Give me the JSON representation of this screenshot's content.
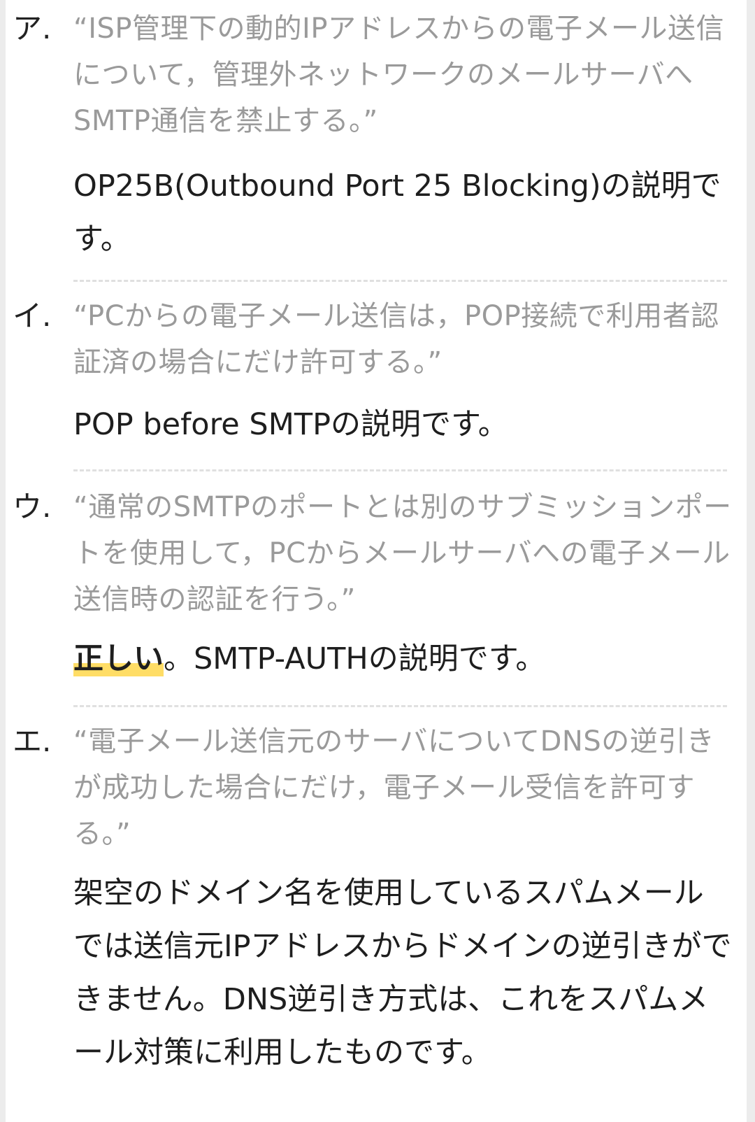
{
  "items": [
    {
      "marker": "ア.",
      "quote": "“ISP管理下の動的IPアドレスからの電子メール送信について，管理外ネットワークのメールサーバへSMTP通信を禁止する。”",
      "answer": "OP25B(Outbound Port 25 Blocking)の説明です。"
    },
    {
      "marker": "イ.",
      "quote": "“PCからの電子メール送信は，POP接続で利用者認証済の場合にだけ許可する。”",
      "answer": "POP before SMTPの説明です。"
    },
    {
      "marker": "ウ.",
      "quote": "“通常のSMTPのポートとは別のサブミッションポートを使用して，PCからメールサーバへの電子メール送信時の認証を行う。”",
      "answer_highlight": "正しい",
      "answer_rest": "。SMTP-AUTHの説明です。"
    },
    {
      "marker": "エ.",
      "quote": "“電子メール送信元のサーバについてDNSの逆引きが成功した場合にだけ，電子メール受信を許可する。”",
      "answer": "架空のドメイン名を使用しているスパムメールでは送信元IPアドレスからドメインの逆引きができません。DNS逆引き方式は、これをスパムメール対策に利用したものです。"
    }
  ]
}
